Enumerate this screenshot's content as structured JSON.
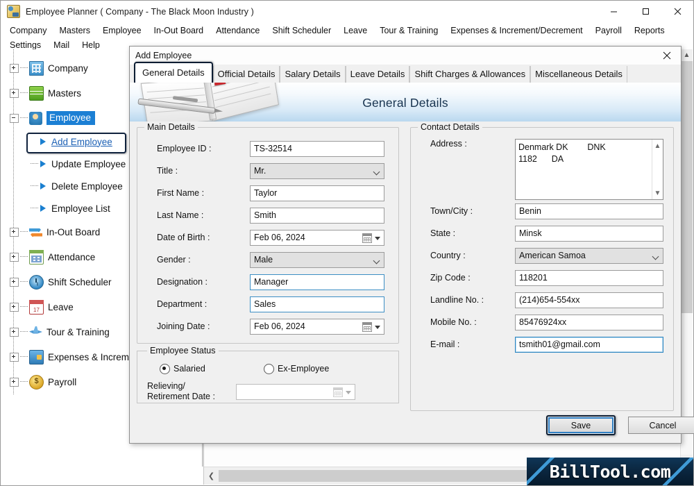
{
  "window": {
    "title": "Employee Planner ( Company - The Black Moon Industry )",
    "minimize_label": "Minimize",
    "maximize_label": "Maximize",
    "close_label": "Close"
  },
  "menubar": {
    "items": [
      "Company",
      "Masters",
      "Employee",
      "In-Out Board",
      "Attendance",
      "Shift Scheduler",
      "Leave",
      "Tour & Training",
      "Expenses & Increment/Decrement",
      "Payroll",
      "Reports",
      "Settings",
      "Mail",
      "Help"
    ]
  },
  "sidebar": {
    "nodes": [
      {
        "label": "Company",
        "icon": "building-icon",
        "state": "collapsed",
        "level": 0
      },
      {
        "label": "Masters",
        "icon": "layers-icon",
        "state": "collapsed",
        "level": 0
      },
      {
        "label": "Employee",
        "icon": "people-icon",
        "state": "expanded",
        "level": 0,
        "selected": true
      },
      {
        "label": "Add Employee",
        "icon": "arrow-icon",
        "level": 1,
        "focused": true
      },
      {
        "label": "Update Employee",
        "icon": "arrow-icon",
        "level": 1
      },
      {
        "label": "Delete Employee",
        "icon": "arrow-icon",
        "level": 1
      },
      {
        "label": "Employee List",
        "icon": "arrow-icon",
        "level": 1
      },
      {
        "label": "In-Out Board",
        "icon": "inout-icon",
        "state": "collapsed",
        "level": 0
      },
      {
        "label": "Attendance",
        "icon": "calendar-icon",
        "state": "collapsed",
        "level": 0
      },
      {
        "label": "Shift Scheduler",
        "icon": "clock-icon",
        "state": "collapsed",
        "level": 0
      },
      {
        "label": "Leave",
        "icon": "date-icon",
        "state": "collapsed",
        "level": 0
      },
      {
        "label": "Tour & Training",
        "icon": "airplane-icon",
        "state": "collapsed",
        "level": 0
      },
      {
        "label": "Expenses & Incremen",
        "icon": "wallet-icon",
        "state": "collapsed",
        "level": 0
      },
      {
        "label": "Payroll",
        "icon": "coin-icon",
        "state": "collapsed",
        "level": 0
      }
    ]
  },
  "dialog": {
    "title": "Add Employee",
    "close_label": "Close",
    "tabs": [
      {
        "label": "General Details",
        "active": true
      },
      {
        "label": "Official Details",
        "active": false
      },
      {
        "label": "Salary Details",
        "active": false
      },
      {
        "label": "Leave Details",
        "active": false
      },
      {
        "label": "Shift Charges & Allowances",
        "active": false
      },
      {
        "label": "Miscellaneous Details",
        "active": false
      }
    ],
    "banner_title": "General Details",
    "main_details": {
      "legend": "Main Details",
      "fields": [
        {
          "label": "Employee ID :",
          "value": "TS-32514",
          "type": "text",
          "style": "plain"
        },
        {
          "label": "Title :",
          "value": "Mr.",
          "type": "combo"
        },
        {
          "label": "First Name :",
          "value": "Taylor",
          "type": "text",
          "style": "plain"
        },
        {
          "label": "Last Name :",
          "value": "Smith",
          "type": "text",
          "style": "plain"
        },
        {
          "label": "Date of Birth :",
          "value": "Feb  06, 2024",
          "type": "date"
        },
        {
          "label": "Gender :",
          "value": "Male",
          "type": "combo"
        },
        {
          "label": "Designation :",
          "value": "Manager",
          "type": "text",
          "style": "blue"
        },
        {
          "label": "Department :",
          "value": "Sales",
          "type": "text",
          "style": "blue"
        },
        {
          "label": "Joining Date :",
          "value": "Feb  06, 2024",
          "type": "date"
        }
      ]
    },
    "employee_status": {
      "legend": "Employee Status",
      "options": [
        {
          "label": "Salaried",
          "selected": true
        },
        {
          "label": "Ex-Employee",
          "selected": false
        }
      ],
      "relieving_label_line1": "Relieving/",
      "relieving_label_line2": "Retirement Date :",
      "relieving_value": ""
    },
    "contact_details": {
      "legend": "Contact Details",
      "address_label": "Address :",
      "address_value": "Denmark DK        DNK\n1182      DA",
      "fields": [
        {
          "label": "Town/City :",
          "value": "Benin",
          "type": "text",
          "style": "plain"
        },
        {
          "label": "State :",
          "value": "Minsk",
          "type": "text",
          "style": "plain"
        },
        {
          "label": "Country :",
          "value": "American Samoa",
          "type": "combo"
        },
        {
          "label": "Zip Code :",
          "value": "118201",
          "type": "text",
          "style": "plain"
        },
        {
          "label": "Landline No. :",
          "value": "(214)654-554xx",
          "type": "text",
          "style": "plain"
        },
        {
          "label": "Mobile No. :",
          "value": "85476924xx",
          "type": "text",
          "style": "plain"
        },
        {
          "label": "E-mail :",
          "value": "tsmith01@gmail.com",
          "type": "text",
          "style": "focus"
        }
      ]
    },
    "buttons": {
      "save": "Save",
      "cancel": "Cancel"
    }
  },
  "watermark": {
    "text": "BillTool.com"
  },
  "colors": {
    "accent": "#1b7fd4",
    "selection": "#1b7fd4",
    "link": "#1a5fb4",
    "focus_border": "#0c1d33",
    "banner_bottom": "#b9d8ef",
    "field_blue": "#3b8ec4"
  }
}
